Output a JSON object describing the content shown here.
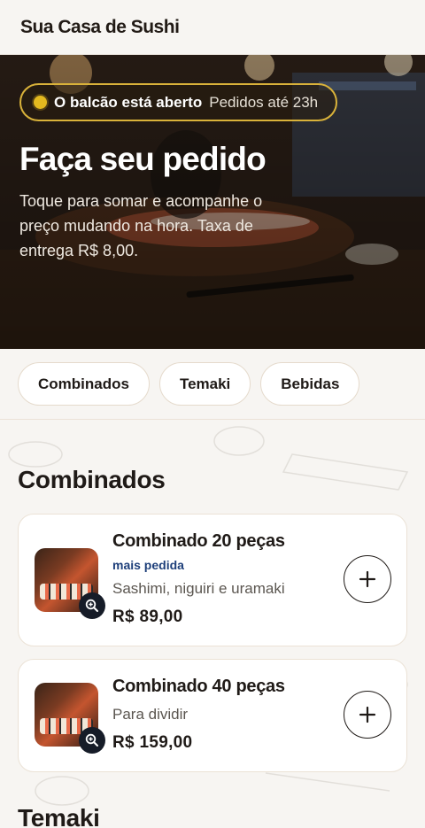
{
  "header": {
    "title": "Sua Casa de Sushi"
  },
  "hero": {
    "status_strong": "O balcão está aberto",
    "status_light": "Pedidos até 23h",
    "title": "Faça seu pedido",
    "subtitle": "Toque para somar e acompanhe o preço mudando na hora. Taxa de entrega R$ 8,00."
  },
  "tabs": [
    {
      "label": "Combinados"
    },
    {
      "label": "Temaki"
    },
    {
      "label": "Bebidas"
    }
  ],
  "sections": [
    {
      "title": "Combinados",
      "items": [
        {
          "name": "Combinado 20 peças",
          "badge": "mais pedida",
          "description": "Sashimi, niguiri e uramaki",
          "price": "R$ 89,00"
        },
        {
          "name": "Combinado 40 peças",
          "description": "Para dividir",
          "price": "R$ 159,00"
        }
      ]
    },
    {
      "title": "Temaki"
    }
  ],
  "icons": {
    "zoom": "zoom-in-icon",
    "add": "plus-icon"
  },
  "colors": {
    "accent": "#e3b91f",
    "badge": "#1e3f7a",
    "text": "#1f1a17",
    "background": "#f7f5f2"
  }
}
